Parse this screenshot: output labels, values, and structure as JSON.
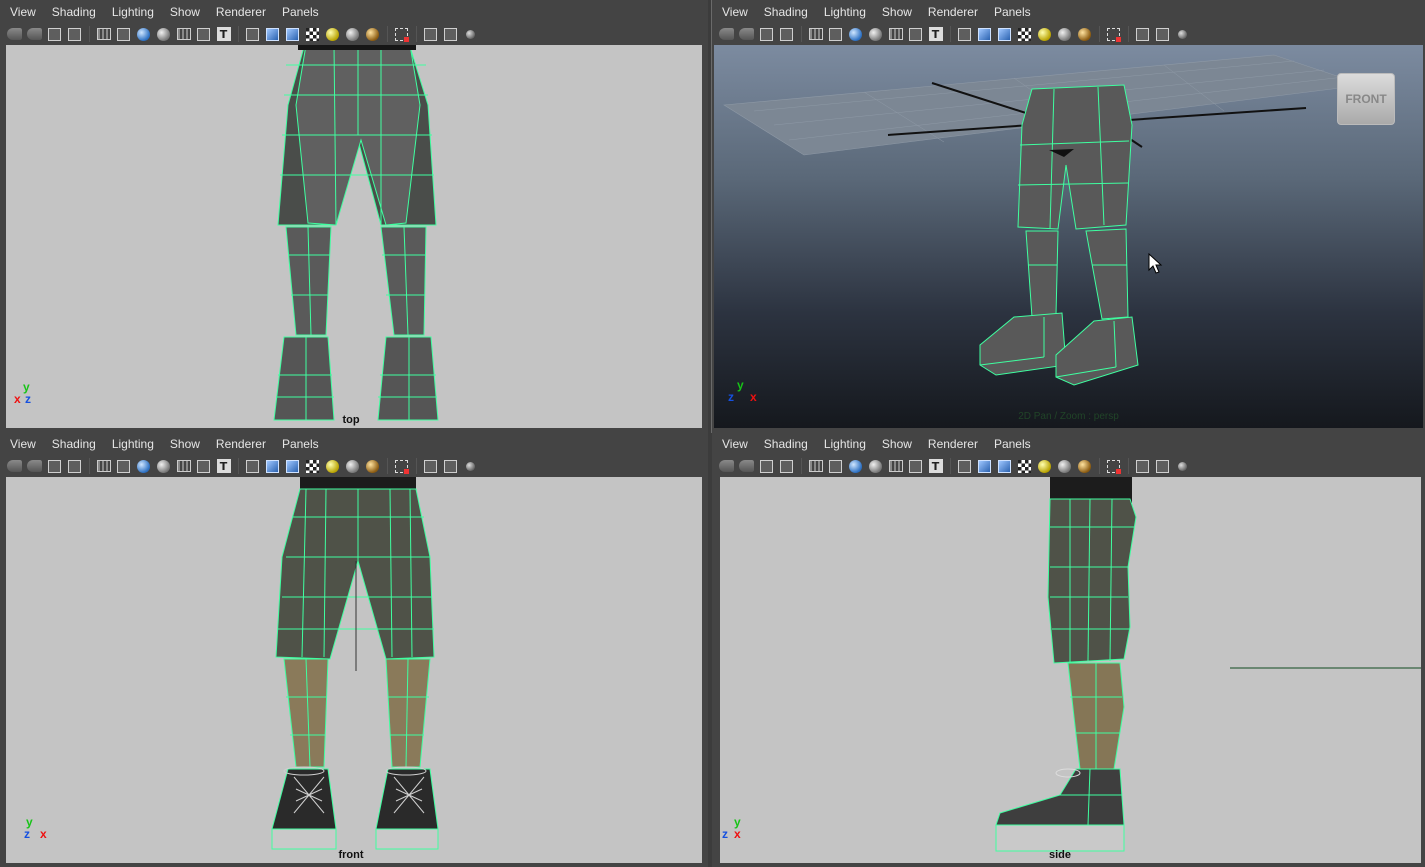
{
  "menus": [
    "View",
    "Shading",
    "Lighting",
    "Show",
    "Renderer",
    "Panels"
  ],
  "panels": {
    "top": {
      "camera_label": "top"
    },
    "persp": {
      "viewcube_label": "FRONT",
      "hud_text": "2D Pan / Zoom : persp"
    },
    "front": {
      "camera_label": "front"
    },
    "side": {
      "camera_label": "side"
    }
  },
  "axes": {
    "x": "x",
    "y": "y",
    "z": "z"
  },
  "colors": {
    "wire": "#3fffa0",
    "viewport_bg": "#c4c4c4",
    "ui_bg": "#444444"
  }
}
